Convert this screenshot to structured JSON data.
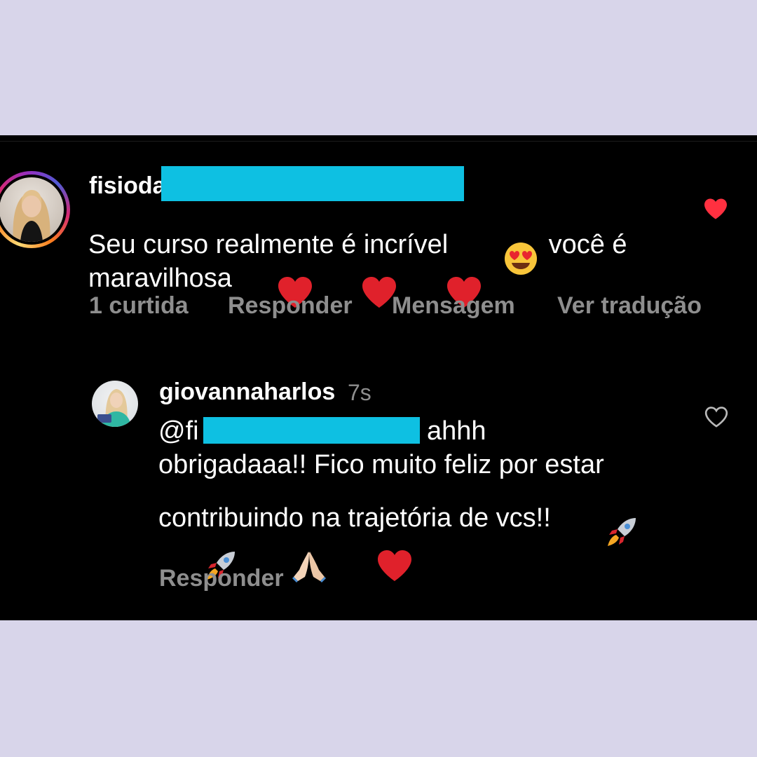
{
  "comment": {
    "username": "fisioda",
    "text_line1_start": "Seu curso realmente é incrível",
    "text_line1_end": "você é",
    "text_line2": "maravilhosa",
    "actions": {
      "likes": "1 curtida",
      "reply": "Responder",
      "message": "Mensagem",
      "translate": "Ver tradução"
    },
    "liked": true
  },
  "reply": {
    "username": "giovannaharlos",
    "timestamp": "7s",
    "mention_prefix": "@fi",
    "text_line1_end": "ahhh",
    "text_line2": "obrigadaaa!! Fico muito feliz por estar",
    "text_line3": "contribuindo na trajetória de vcs!!",
    "action_reply": "Responder",
    "liked": false
  },
  "colors": {
    "background": "#d8d5ea",
    "panel": "#000000",
    "redaction": "#0ec0e2",
    "heart_red": "#ff3040",
    "muted_text": "#8e8e8e"
  },
  "icons": [
    "heart-filled-icon",
    "heart-outline-icon",
    "heart-eyes-emoji",
    "red-heart-emoji",
    "rocket-emoji",
    "folded-hands-emoji"
  ]
}
